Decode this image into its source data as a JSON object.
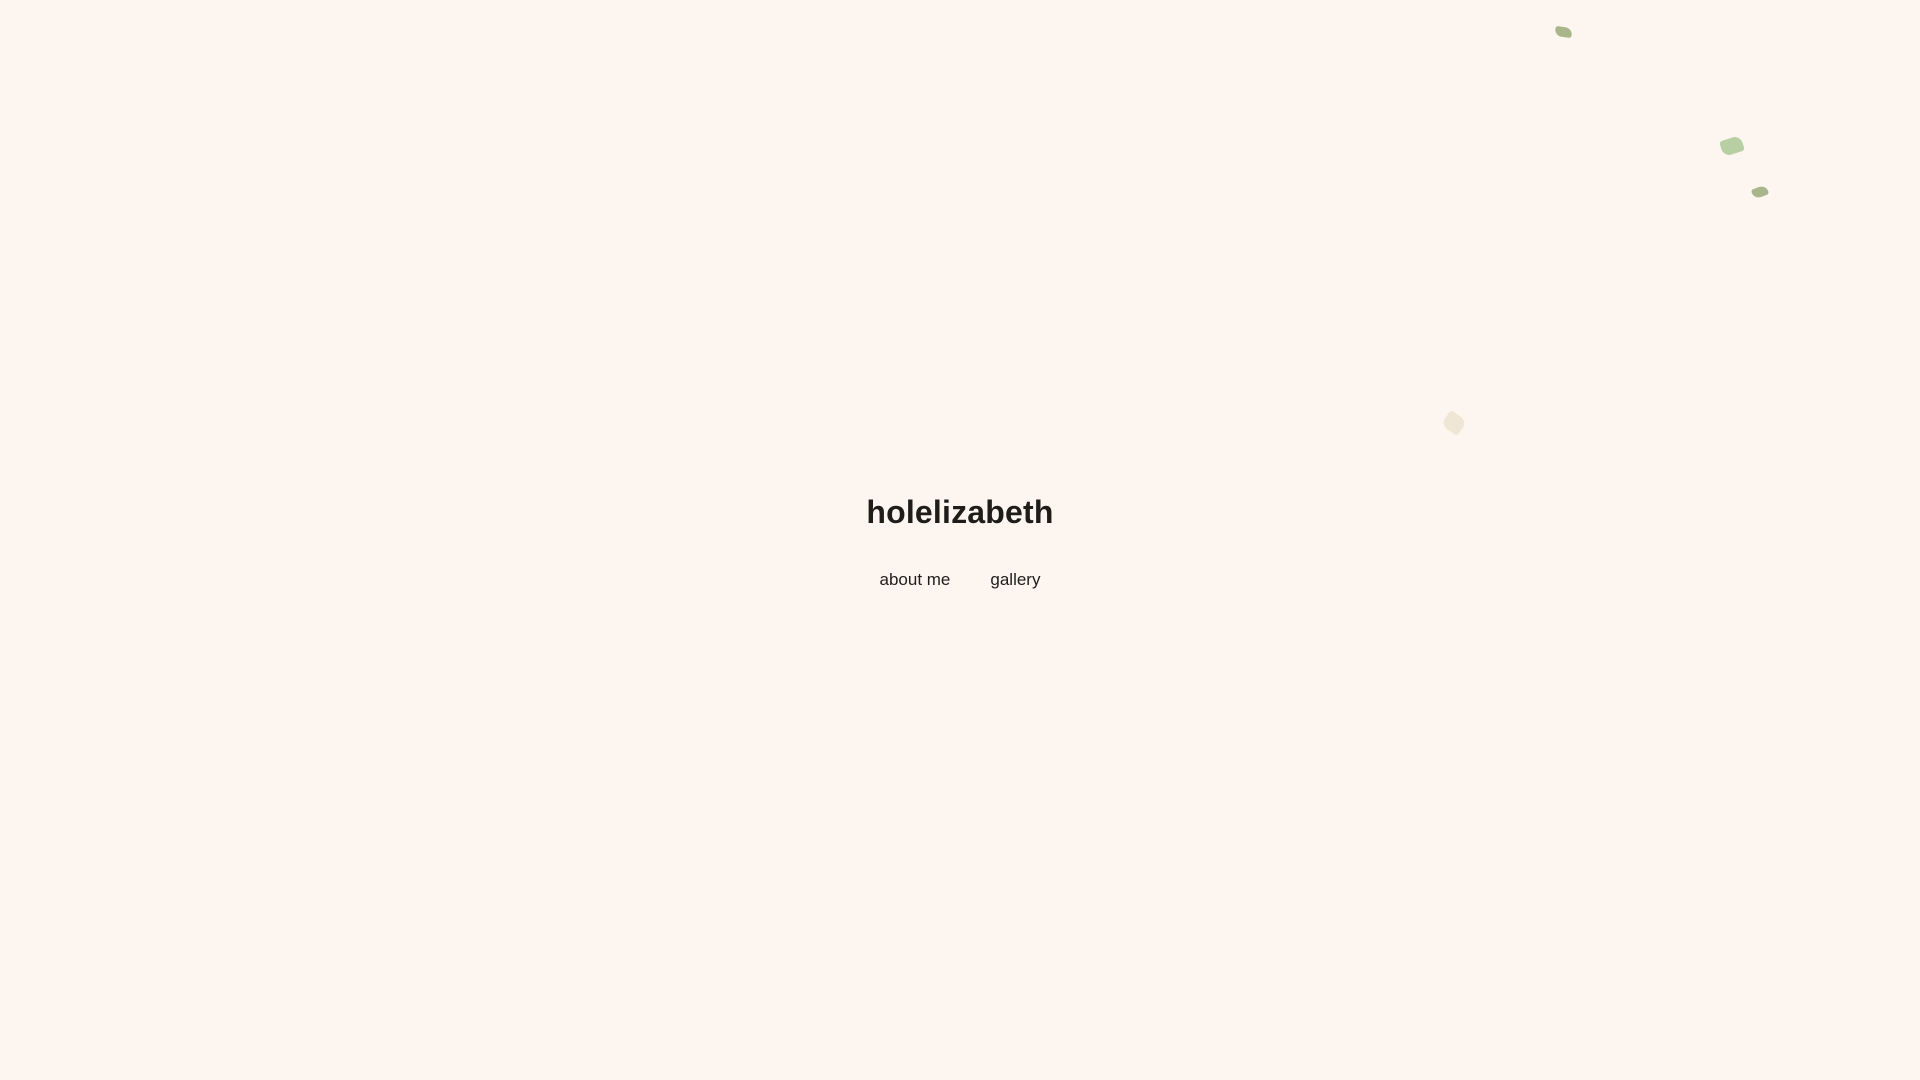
{
  "site": {
    "title": "holelizabeth"
  },
  "nav": {
    "items": [
      {
        "label": "about me"
      },
      {
        "label": "gallery"
      }
    ]
  },
  "decorations": {
    "leaf_icons": [
      "leaf-icon",
      "leaf-icon",
      "leaf-icon",
      "leaf-icon"
    ],
    "colors": {
      "background": "#fdf6f0",
      "leaf_olive": "#a9b58a",
      "leaf_sage": "#b8cfa3",
      "leaf_pale": "#f0e6d6",
      "text": "#1f1d1a"
    }
  }
}
